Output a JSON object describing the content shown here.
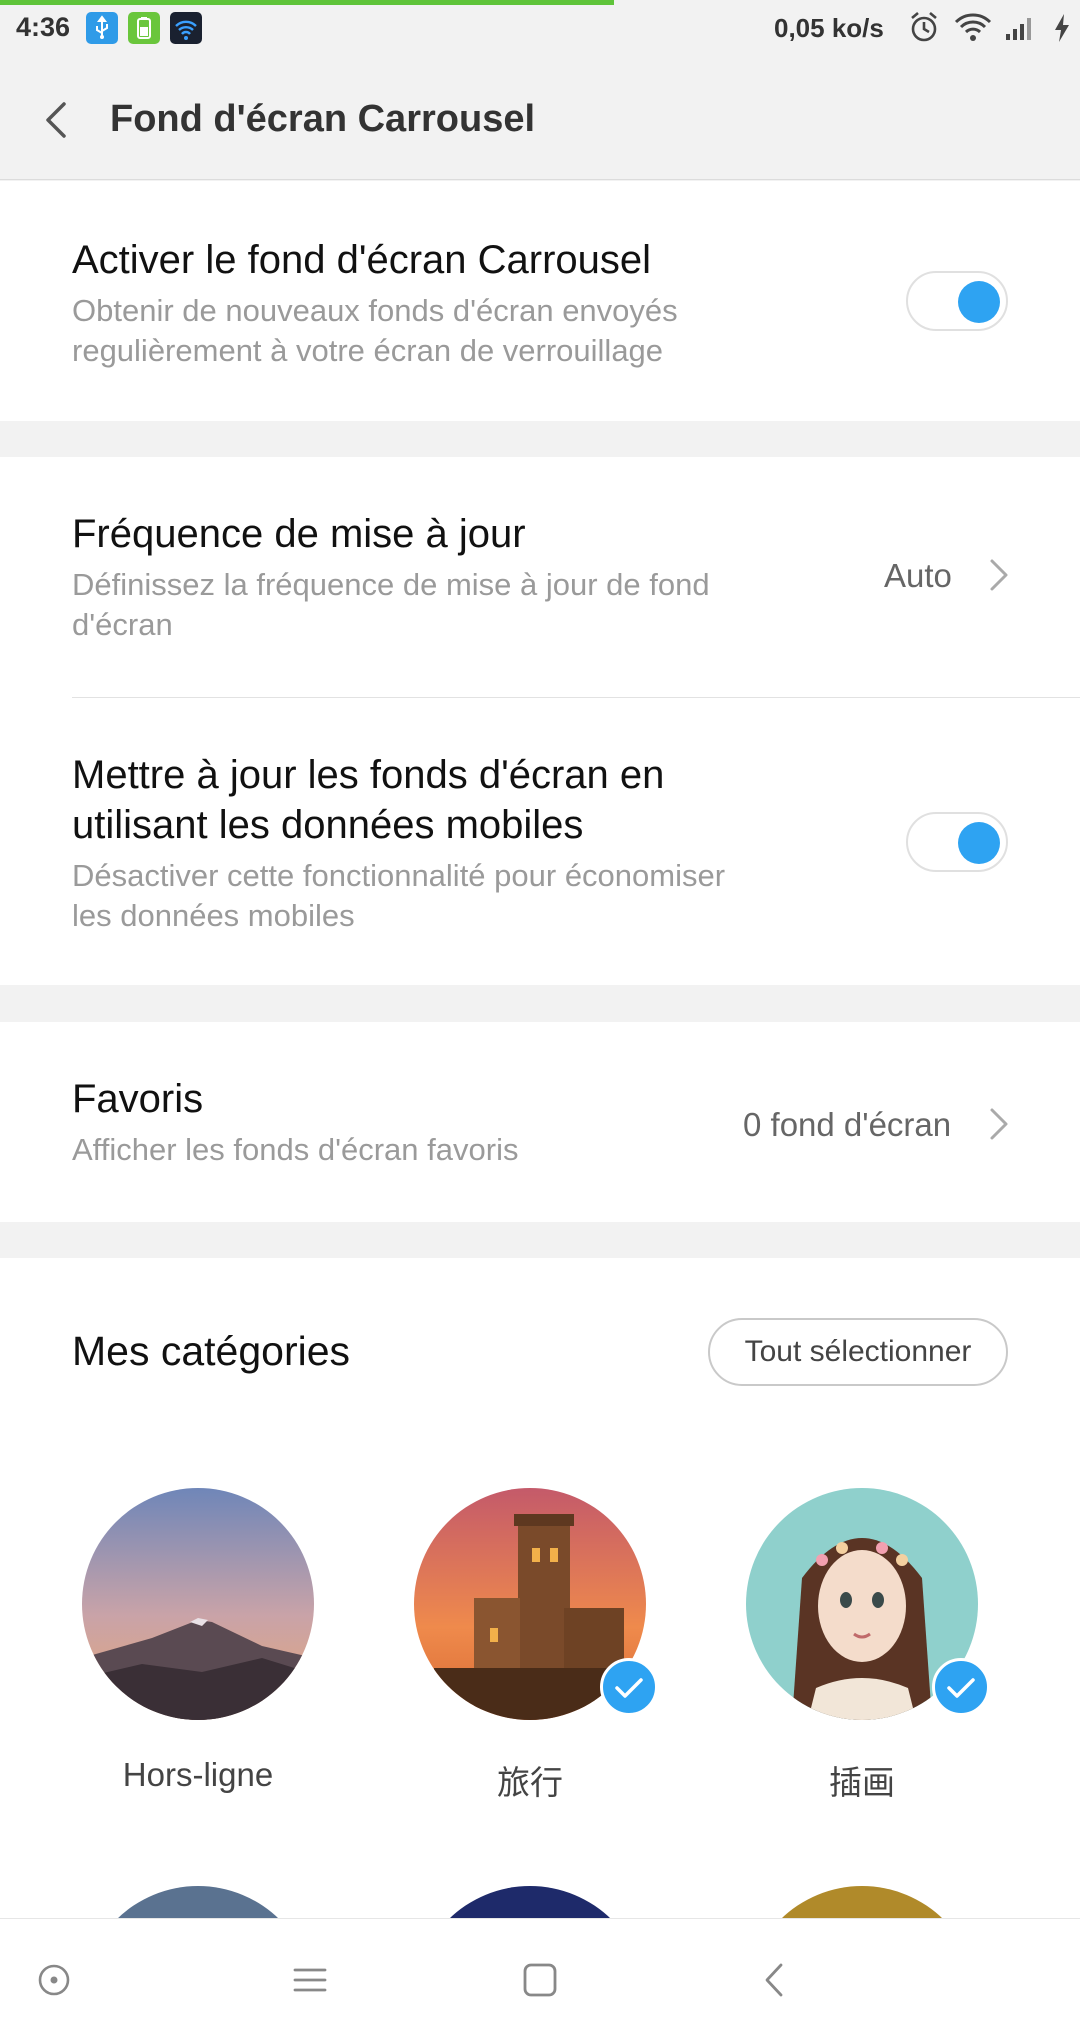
{
  "status_bar": {
    "time": "4:36",
    "network_speed": "0,05 ko/s",
    "icons": [
      "usb-icon",
      "battery-app-icon",
      "wifi-app-icon",
      "alarm-icon",
      "wifi-icon",
      "signal-icon",
      "charging-icon"
    ]
  },
  "header": {
    "title": "Fond d'écran Carrousel",
    "back_icon": "chevron-left-icon"
  },
  "settings": {
    "activate": {
      "title": "Activer le fond d'écran Carrousel",
      "subtitle_line1": "Obtenir de nouveaux fonds d'écran envoyés",
      "subtitle_line2": "regulièrement à votre écran de verrouillage",
      "enabled": true
    },
    "frequency": {
      "title": "Fréquence de mise à jour",
      "subtitle_line1": "Définissez la fréquence de mise à jour de fond",
      "subtitle_line2": "d'écran",
      "value": "Auto"
    },
    "mobile_data": {
      "title_line1": "Mettre à jour les fonds d'écran en",
      "title_line2": "utilisant les données mobiles",
      "subtitle_line1": "Désactiver cette fonctionnalité pour économiser",
      "subtitle_line2": "les données mobiles",
      "enabled": true
    },
    "favorites": {
      "title": "Favoris",
      "subtitle": "Afficher les fonds d'écran favoris",
      "value": "0 fond d'écran"
    }
  },
  "categories": {
    "title": "Mes catégories",
    "select_all_label": "Tout sélectionner",
    "items": [
      {
        "label": "Hors-ligne",
        "selected": false
      },
      {
        "label": "旅行",
        "selected": true
      },
      {
        "label": "插画",
        "selected": true
      }
    ]
  },
  "nav_bar": {
    "icons": [
      "assistant-icon",
      "menu-icon",
      "home-icon",
      "back-icon"
    ]
  },
  "colors": {
    "accent": "#2ea3f2",
    "progress": "#5fc43a",
    "background": "#f2f2f2"
  }
}
